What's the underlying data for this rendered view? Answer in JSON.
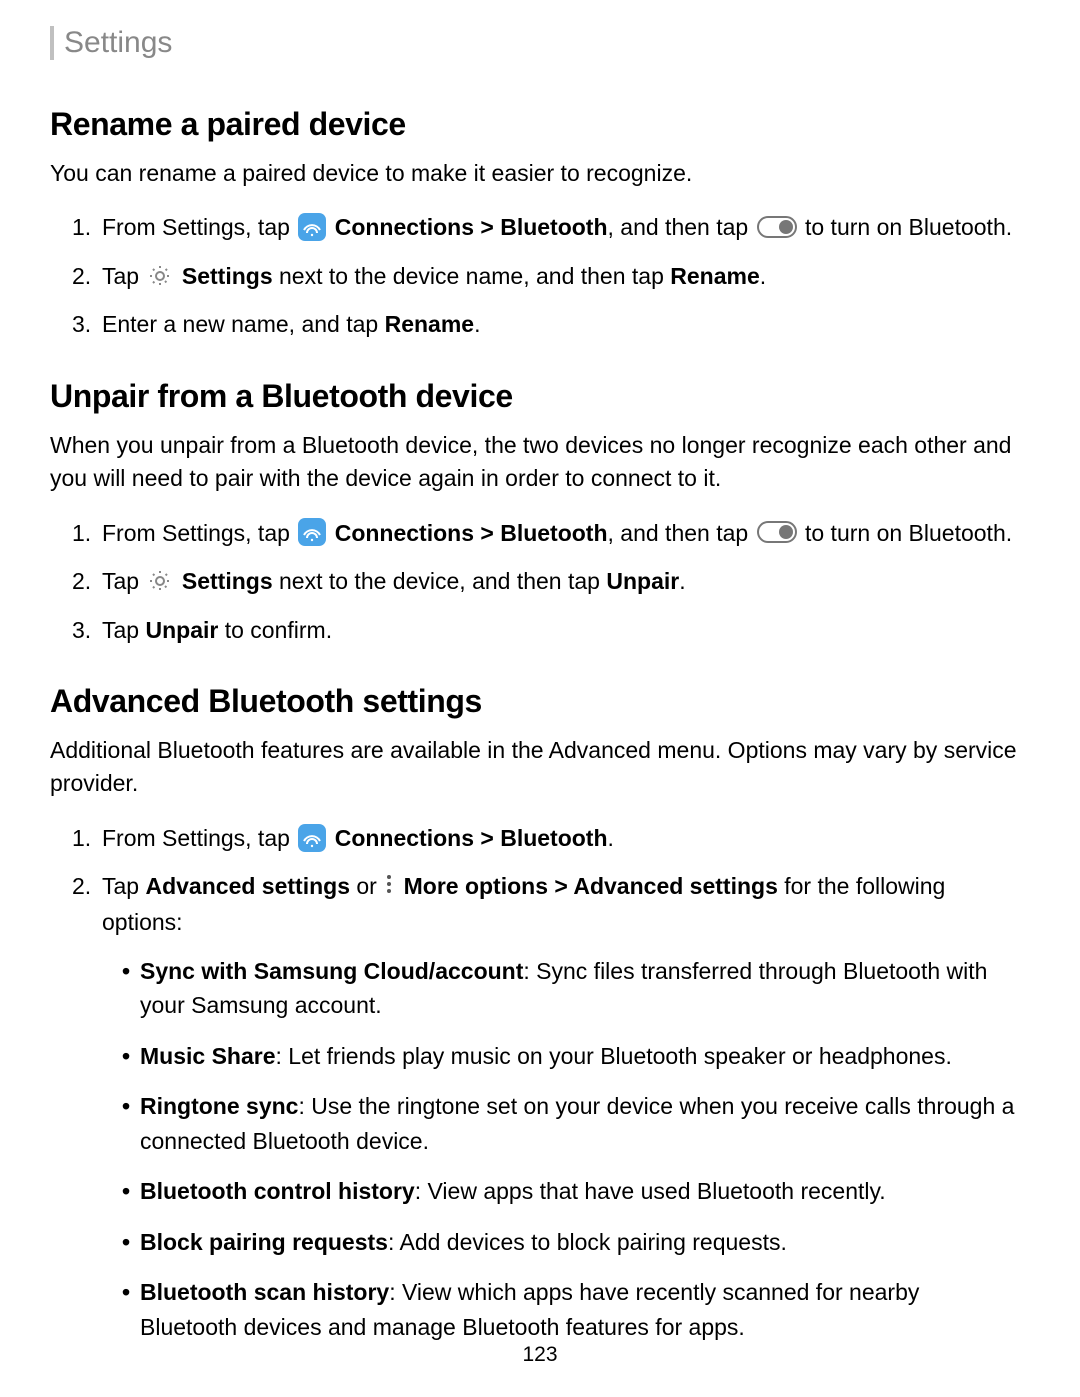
{
  "header": {
    "title": "Settings"
  },
  "sections": {
    "rename": {
      "heading": "Rename a paired device",
      "intro": "You can rename a paired device to make it easier to recognize.",
      "step1_pre": "From Settings, tap ",
      "step1_conn": "Connections",
      "step1_sep": " > ",
      "step1_bt": "Bluetooth",
      "step1_mid": ", and then tap ",
      "step1_post": " to turn on Bluetooth.",
      "step2_pre": "Tap ",
      "step2_settings": "Settings",
      "step2_mid": " next to the device name, and then tap ",
      "step2_rename": "Rename",
      "step2_end": ".",
      "step3_pre": "Enter a new name, and tap ",
      "step3_rename": "Rename",
      "step3_end": "."
    },
    "unpair": {
      "heading": "Unpair from a Bluetooth device",
      "intro": "When you unpair from a Bluetooth device, the two devices no longer recognize each other and you will need to pair with the device again in order to connect to it.",
      "step1_pre": "From Settings, tap ",
      "step1_conn": "Connections",
      "step1_sep": " > ",
      "step1_bt": "Bluetooth",
      "step1_mid": ", and then tap ",
      "step1_post": " to turn on Bluetooth.",
      "step2_pre": "Tap ",
      "step2_settings": "Settings",
      "step2_mid": " next to the device, and then tap ",
      "step2_unpair": "Unpair",
      "step2_end": ".",
      "step3_pre": "Tap ",
      "step3_unpair": "Unpair",
      "step3_end": " to confirm."
    },
    "advanced": {
      "heading": "Advanced Bluetooth settings",
      "intro": "Additional Bluetooth features are available in the Advanced menu. Options may vary by service provider.",
      "step1_pre": "From Settings, tap ",
      "step1_conn": "Connections",
      "step1_sep": " > ",
      "step1_bt": "Bluetooth",
      "step1_end": ".",
      "step2_pre": "Tap ",
      "step2_adv": "Advanced settings",
      "step2_or": " or ",
      "step2_more": "More options",
      "step2_sep": " > ",
      "step2_adv2": "Advanced settings",
      "step2_post": " for the following options:",
      "bullets": {
        "b1_bold": "Sync with Samsung Cloud/account",
        "b1_rest": ": Sync files transferred through Bluetooth with your Samsung account.",
        "b2_bold": "Music Share",
        "b2_rest": ": Let friends play music on your Bluetooth speaker or headphones.",
        "b3_bold": "Ringtone sync",
        "b3_rest": ": Use the ringtone set on your device when you receive calls through a connected Bluetooth device.",
        "b4_bold": "Bluetooth control history",
        "b4_rest": ": View apps that have used Bluetooth recently.",
        "b5_bold": "Block pairing requests",
        "b5_rest": ": Add devices to block pairing requests.",
        "b6_bold": "Bluetooth scan history",
        "b6_rest": ": View which apps have recently scanned for nearby Bluetooth devices and manage Bluetooth features for apps."
      }
    }
  },
  "page_number": "123"
}
